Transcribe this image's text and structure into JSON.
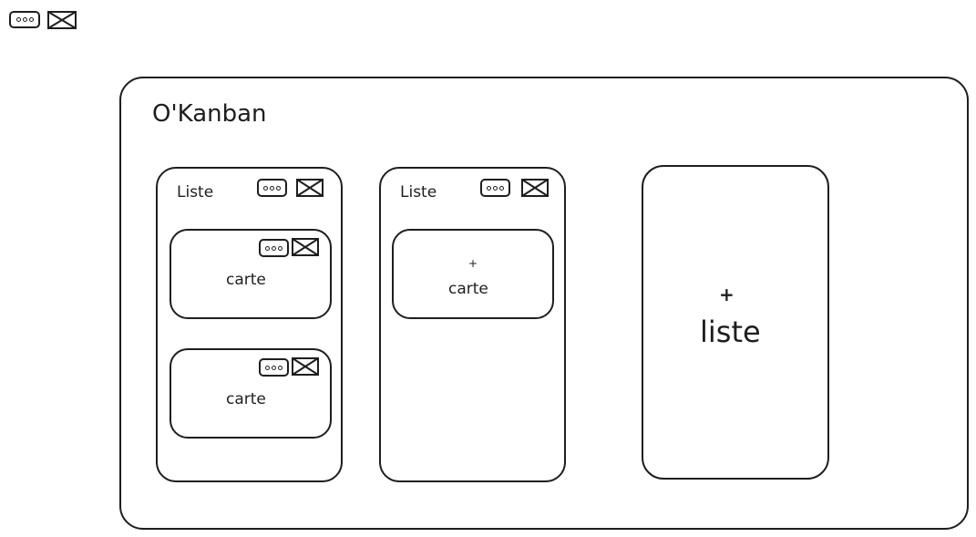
{
  "app": {
    "title": "O'Kanban"
  },
  "icons": {
    "menu": "more-horizontal-icon",
    "delete": "delete-x-box-icon"
  },
  "lists": [
    {
      "title": "Liste",
      "cards": [
        {
          "label": "carte"
        },
        {
          "label": "carte"
        }
      ]
    },
    {
      "title": "Liste",
      "add_card": {
        "plus": "+",
        "label": "carte"
      }
    }
  ],
  "add_list": {
    "plus": "+",
    "label": "liste"
  },
  "colors": {
    "stroke": "#1e1e1e",
    "background": "#ffffff"
  }
}
